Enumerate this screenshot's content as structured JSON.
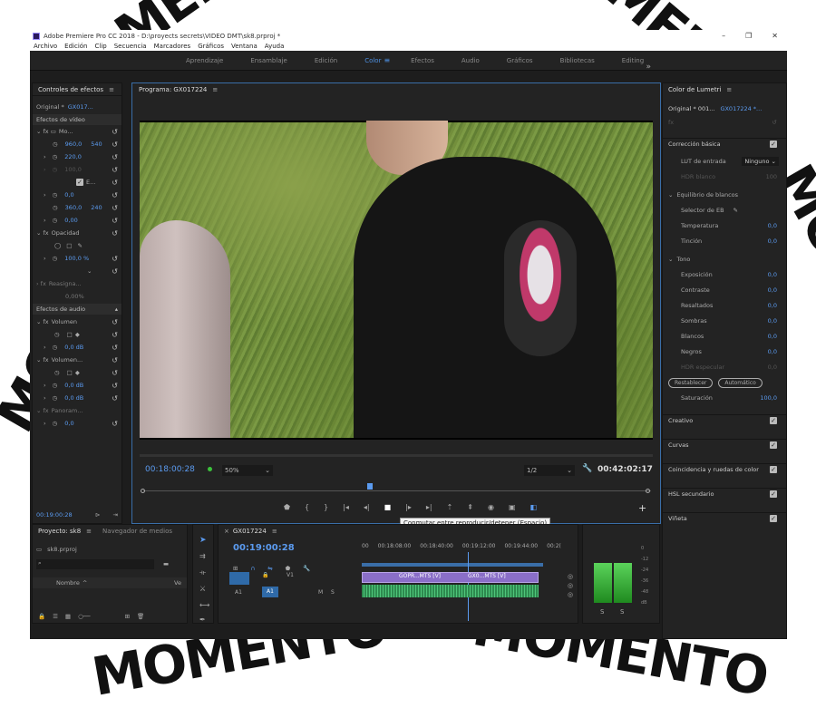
{
  "watermark": {
    "word": "MOMENTO"
  },
  "app": {
    "title": "Adobe Premiere Pro CC 2018 - D:\\proyects secrets\\VIDEO DMT\\sk8.prproj *",
    "menu": [
      "Archivo",
      "Edición",
      "Clip",
      "Secuencia",
      "Marcadores",
      "Gráficos",
      "Ventana",
      "Ayuda"
    ],
    "workspaces": [
      "Aprendizaje",
      "Ensamblaje",
      "Edición",
      "Color",
      "Efectos",
      "Audio",
      "Gráficos",
      "Bibliotecas",
      "Editing"
    ],
    "active_workspace": "Color"
  },
  "effect_controls": {
    "title": "Controles de efectos",
    "source": "Original *",
    "clip": "GX017...",
    "video_effects": "Efectos de vídeo",
    "motion": "Mo...",
    "pos_x": "960,0",
    "pos_y_partial": "540",
    "scale": "220,0",
    "scale_w": "100,0",
    "uniform": "E...",
    "rotation": "0,0",
    "anchor_x": "360,0",
    "anchor_y_partial": "240",
    "flicker": "0,00",
    "opacity": "Opacidad",
    "opacity_val": "100,0 %",
    "remap": "Reasigna...",
    "remap_val": "0,00%",
    "audio_effects": "Efectos de audio",
    "volume1": "Volumen",
    "vol_val": "0,0 dB",
    "volume2": "Volumen...",
    "vol2_val1": "0,0 dB",
    "vol2_val2": "0,0 dB",
    "panner": "Panoram...",
    "pan_val": "0,0",
    "timecode": "00:19:00:28"
  },
  "program": {
    "title": "Programa: GX017224",
    "timecode_left": "00:18:00:28",
    "zoom": "50%",
    "quality": "1/2",
    "timecode_right": "00:42:02:17",
    "tooltip": "Conmutar entre reproducir/detener (Espacio)"
  },
  "lumetri": {
    "title": "Color de Lumetri",
    "source": "Original * 001...",
    "clip": "GX017224 *...",
    "basic": "Corrección básica",
    "lut_label": "LUT de entrada",
    "lut_value": "Ninguno",
    "hdr_white": "HDR blanco",
    "hdr_white_val": "100",
    "wb": "Equilibrio de blancos",
    "wb_selector": "Selector de EB",
    "temperature": "Temperatura",
    "tint": "Tinción",
    "tone": "Tono",
    "exposure": "Exposición",
    "contrast": "Contraste",
    "highlights": "Resaltados",
    "shadows": "Sombras",
    "whites": "Blancos",
    "blacks": "Negros",
    "hdr_specular": "HDR especular",
    "zero": "0,0",
    "reset_btn": "Restablecer",
    "auto_btn": "Automático",
    "saturation": "Saturación",
    "saturation_val": "100,0",
    "creative": "Creativo",
    "curves": "Curvas",
    "color_match": "Coincidencia y ruedas de color",
    "hsl": "HSL secundario",
    "vignette": "Viñeta"
  },
  "project": {
    "tab1": "Proyecto: sk8",
    "tab2": "Navegador de medios",
    "file": "sk8.prproj",
    "col_name": "Nombre",
    "col_v": "Ve"
  },
  "timeline": {
    "seq": "GX017224",
    "timecode": "00:19:00:28",
    "ruler": [
      "00",
      "00:18:08:00",
      "00:18:40:00",
      "00:19:12:00",
      "00:19:44:00",
      "00:2("
    ],
    "clip1": "GOPR...MTS [V]",
    "clip2": "GX0...MTS [V]",
    "track_v": "V1",
    "track_a": "A1",
    "m": "M",
    "s": "S"
  },
  "meter": {
    "labels": [
      "0",
      "-12",
      "-24",
      "-36",
      "-48",
      "dB"
    ],
    "solo": [
      "S",
      "S"
    ]
  }
}
